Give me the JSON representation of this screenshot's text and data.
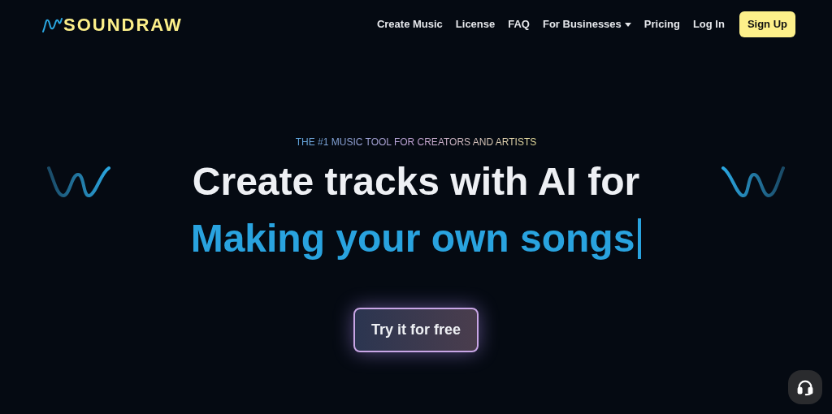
{
  "logo": {
    "text": "SOUNDRAW"
  },
  "nav": [
    {
      "label": "Create Music",
      "kind": "link"
    },
    {
      "label": "License",
      "kind": "link"
    },
    {
      "label": "FAQ",
      "kind": "link"
    },
    {
      "label": "For Businesses",
      "kind": "dropdown"
    },
    {
      "label": "Pricing",
      "kind": "link"
    },
    {
      "label": "Log In",
      "kind": "link"
    },
    {
      "label": "Sign Up",
      "kind": "button"
    }
  ],
  "hero": {
    "tagline": "THE #1 MUSIC TOOL FOR CREATORS AND ARTISTS",
    "headline": "Create tracks with AI for",
    "typed_text": "Making your own songs",
    "cta": "Try it for free"
  }
}
